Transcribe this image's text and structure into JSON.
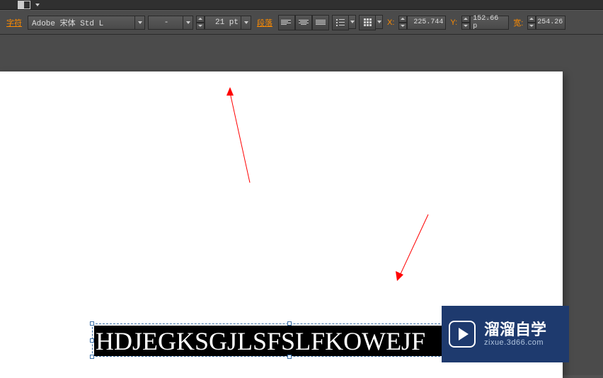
{
  "toolbar": {
    "char_label": "字符",
    "font_family": "Adobe 宋体 Std L",
    "font_style": "-",
    "font_size": "21 pt",
    "para_label": "段落",
    "x_label": "X:",
    "x_value": "225.744 ",
    "y_label": "Y:",
    "y_value": "152.66 p",
    "w_label": "宽:",
    "w_value": "254.26"
  },
  "canvas": {
    "text_content": "HDJEGKSGJLSFSLFKOWEJF"
  },
  "watermark": {
    "title": "溜溜自学",
    "url": "zixue.3d66.com"
  }
}
